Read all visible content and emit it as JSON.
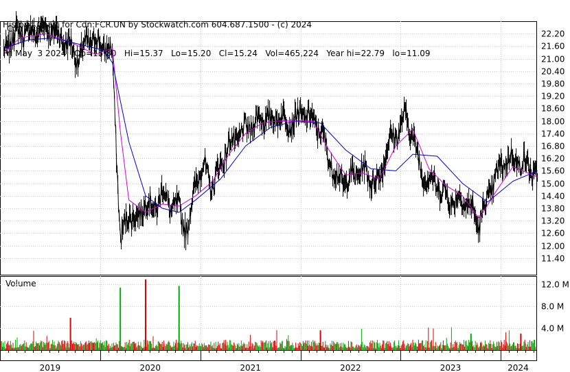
{
  "header": {
    "line1": "Historic Chart for Cdn:FCR.UN by Stockwatch.com 604.687.1500 - (c) 2024",
    "line2": "Fri May  3 2024   Op=15.30   Hi=15.37   Lo=15.20   Cl=15.24   Vol=465,224   Year hi=22.79   lo=11.09"
  },
  "chart_data": [
    {
      "type": "line",
      "title": "Cdn:FCR.UN",
      "xlabel": "",
      "ylabel": "",
      "x_range": [
        "2019-01",
        "2024-05"
      ],
      "ylim": [
        10.6,
        22.8
      ],
      "y_ticks": [
        "22.20",
        "21.60",
        "21.00",
        "20.40",
        "19.80",
        "19.20",
        "18.60",
        "18.00",
        "17.40",
        "16.80",
        "16.20",
        "15.60",
        "15.00",
        "14.40",
        "13.80",
        "13.20",
        "12.60",
        "12.00",
        "11.40"
      ],
      "x_ticks": [
        "2019",
        "2020",
        "2021",
        "2022",
        "2023",
        "2024"
      ],
      "grid": true,
      "series": [
        {
          "color": "#000000",
          "x": [
            "2019-01",
            "2019-02",
            "2019-03",
            "2019-04",
            "2019-05",
            "2019-06",
            "2019-07",
            "2019-08",
            "2019-09",
            "2019-10",
            "2019-11",
            "2019-12",
            "2020-01",
            "2020-02",
            "2020-03",
            "2020-04",
            "2020-05",
            "2020-06",
            "2020-07",
            "2020-08",
            "2020-09",
            "2020-10",
            "2020-11",
            "2020-12",
            "2021-01",
            "2021-02",
            "2021-03",
            "2021-04",
            "2021-05",
            "2021-06",
            "2021-07",
            "2021-08",
            "2021-09",
            "2021-10",
            "2021-11",
            "2021-12",
            "2022-01",
            "2022-02",
            "2022-03",
            "2022-04",
            "2022-05",
            "2022-06",
            "2022-07",
            "2022-08",
            "2022-09",
            "2022-10",
            "2022-11",
            "2022-12",
            "2023-01",
            "2023-02",
            "2023-03",
            "2023-04",
            "2023-05",
            "2023-06",
            "2023-07",
            "2023-08",
            "2023-09",
            "2023-10",
            "2023-11",
            "2023-12",
            "2024-01",
            "2024-02",
            "2024-03",
            "2024-04",
            "2024-05"
          ],
          "values": [
            21.2,
            22.1,
            22.3,
            22.2,
            22.3,
            22.5,
            22.3,
            22.0,
            21.6,
            20.9,
            21.9,
            21.8,
            21.6,
            21.2,
            12.2,
            13.6,
            13.2,
            14.2,
            13.7,
            14.6,
            13.9,
            13.8,
            12.6,
            15.2,
            15.8,
            14.8,
            15.9,
            16.8,
            17.2,
            17.6,
            17.9,
            18.2,
            18.0,
            18.3,
            17.9,
            18.1,
            18.4,
            18.0,
            17.6,
            16.2,
            15.2,
            15.1,
            15.4,
            15.7,
            15.2,
            15.1,
            16.9,
            17.3,
            18.2,
            17.4,
            15.6,
            15.2,
            14.9,
            14.4,
            14.1,
            14.3,
            13.8,
            13.0,
            14.3,
            15.3,
            16.1,
            16.2,
            16.0,
            15.8,
            15.24
          ]
        },
        {
          "color": "#d000d0",
          "x": [
            "2019-01",
            "2019-03",
            "2019-06",
            "2019-09",
            "2019-12",
            "2020-02",
            "2020-03",
            "2020-04",
            "2020-06",
            "2020-08",
            "2020-10",
            "2020-12",
            "2021-02",
            "2021-04",
            "2021-06",
            "2021-08",
            "2021-10",
            "2021-12",
            "2022-02",
            "2022-04",
            "2022-06",
            "2022-08",
            "2022-10",
            "2022-12",
            "2023-02",
            "2023-04",
            "2023-06",
            "2023-08",
            "2023-10",
            "2023-12",
            "2024-02",
            "2024-05"
          ],
          "values": [
            21.3,
            22.0,
            22.2,
            21.8,
            21.2,
            21.5,
            17.5,
            14.2,
            13.6,
            14.0,
            13.9,
            14.4,
            15.1,
            16.4,
            17.4,
            17.9,
            18.0,
            18.0,
            18.0,
            16.6,
            15.4,
            15.5,
            15.2,
            16.8,
            17.6,
            15.7,
            14.9,
            14.4,
            13.3,
            14.6,
            15.8,
            15.3
          ]
        },
        {
          "color": "#0000cc",
          "x": [
            "2019-01",
            "2019-04",
            "2019-07",
            "2019-10",
            "2020-01",
            "2020-02",
            "2020-04",
            "2020-06",
            "2020-08",
            "2020-10",
            "2020-12",
            "2021-03",
            "2021-06",
            "2021-09",
            "2021-12",
            "2022-03",
            "2022-06",
            "2022-09",
            "2022-12",
            "2023-02",
            "2023-05",
            "2023-08",
            "2023-11",
            "2024-02",
            "2024-05"
          ],
          "values": [
            21.5,
            21.9,
            22.0,
            21.7,
            21.4,
            20.8,
            17.0,
            14.4,
            13.8,
            13.6,
            14.2,
            15.2,
            16.8,
            17.7,
            18.0,
            17.9,
            16.6,
            15.7,
            15.6,
            16.4,
            16.3,
            15.0,
            14.1,
            15.1,
            15.6
          ]
        }
      ]
    },
    {
      "type": "bar",
      "title": "Volume",
      "ylim": [
        0,
        13.5
      ],
      "y_ticks": [
        "12.0 M",
        "8.0 M",
        "4.0 M"
      ],
      "colors": {
        "up": "#00aa00",
        "down": "#dd0000"
      },
      "spikes": [
        {
          "x": "2019-09",
          "value": 5.9
        },
        {
          "x": "2020-03",
          "value": 11.4
        },
        {
          "x": "2020-06",
          "value": 12.9
        },
        {
          "x": "2020-10",
          "value": 11.7
        },
        {
          "x": "2022-03",
          "value": 3.6
        },
        {
          "x": "2023-09",
          "value": 3.0
        },
        {
          "x": "2024-03",
          "value": 3.0
        }
      ],
      "typical_value": 1.0
    }
  ]
}
